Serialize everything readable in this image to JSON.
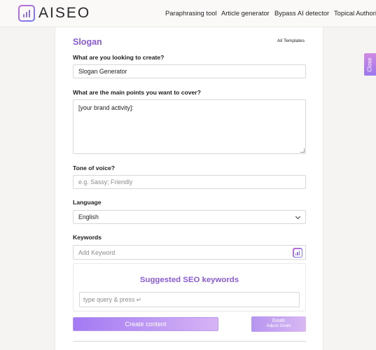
{
  "brand": {
    "name": "AISEO"
  },
  "nav": {
    "items": [
      "Paraphrasing tool",
      "Article generator",
      "Bypass AI detector",
      "Topical Authorit"
    ]
  },
  "form": {
    "title": "Slogan",
    "all_templates": "All Templates",
    "create_label": "What are you looking to create?",
    "create_value": "Slogan Generator",
    "points_label": "What are the main points you want to cover?",
    "points_value": "[your brand activity]:",
    "tone_label": "Tone of voice?",
    "tone_placeholder": "e.g. Sassy; Friendly",
    "language_label": "Language",
    "language_value": "English",
    "keywords_label": "Keywords",
    "keyword_placeholder": "Add Keyword",
    "seo_title": "Suggested SEO keywords",
    "seo_placeholder": "type query & press ↵",
    "create_button": "Create content",
    "goals_button": "Goals",
    "goals_sub": "Adjust Goals"
  },
  "close_tab": {
    "label": "Close"
  },
  "colors": {
    "accent": "#8a5bd6",
    "button_start": "#a37af3",
    "button_end": "#d6b4f5"
  }
}
